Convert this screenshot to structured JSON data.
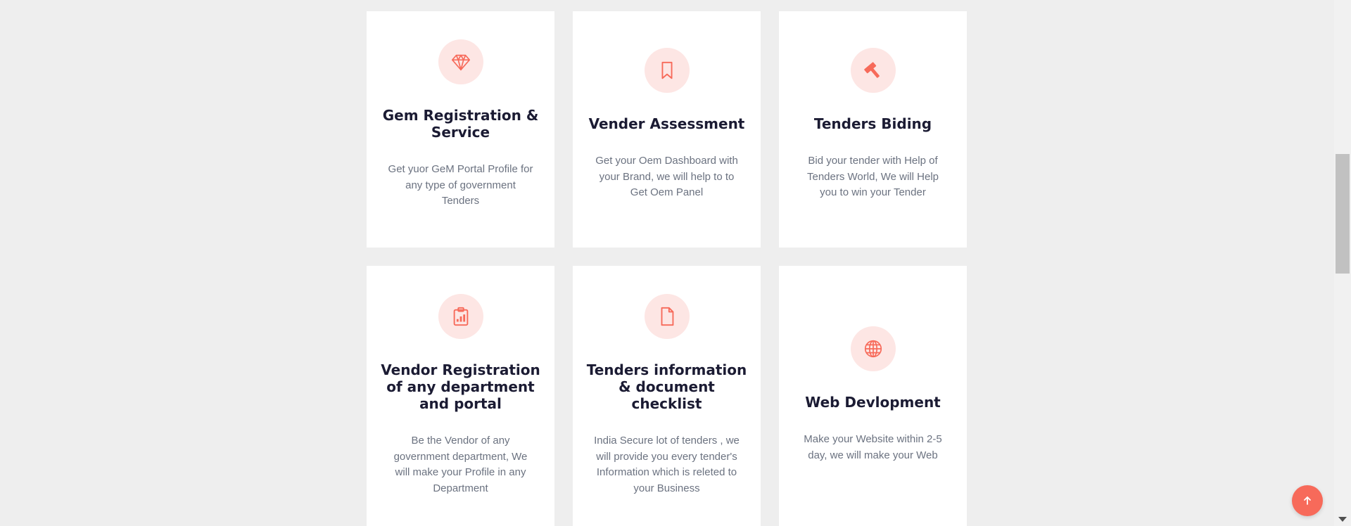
{
  "colors": {
    "accent": "#f76a5a",
    "icon_bg": "#fde6e4",
    "page_bg": "#eeeeee",
    "title": "#1b1b33",
    "text": "#6b7280"
  },
  "services": [
    {
      "icon": "diamond-icon",
      "title": "Gem Registration & Service",
      "description": "Get yuor GeM Portal Profile for any type of government Tenders"
    },
    {
      "icon": "bookmark-icon",
      "title": "Vender Assessment",
      "description": "Get your Oem Dashboard with your Brand, we will help to to Get Oem Panel"
    },
    {
      "icon": "hammer-icon",
      "title": "Tenders Biding",
      "description": "Bid your tender with Help of Tenders World, We will Help you to win your Tender"
    },
    {
      "icon": "clipboard-chart-icon",
      "title": "Vendor Registration of any department and portal",
      "description": "Be the Vendor of any government department, We will make your Profile in any Department"
    },
    {
      "icon": "document-icon",
      "title": "Tenders information & document checklist",
      "description": "India Secure lot of tenders , we will provide you every tender's Information which is releted to your Business"
    },
    {
      "icon": "globe-icon",
      "title": "Web Devlopment",
      "description": "Make your Website within 2-5 day, we will make your Web"
    }
  ],
  "back_to_top": {
    "icon": "arrow-up-icon"
  }
}
